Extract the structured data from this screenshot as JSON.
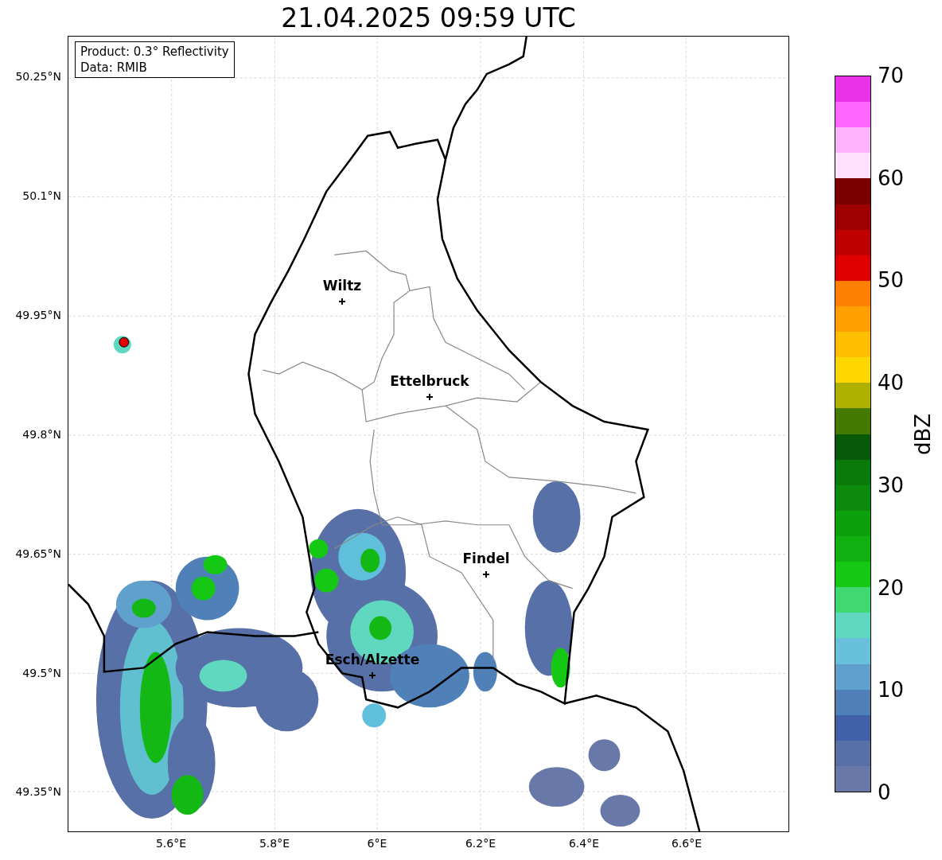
{
  "title": "21.04.2025 09:59 UTC",
  "info_box": [
    "Product: 0.3° Reflectivity",
    "Data: RMIB"
  ],
  "cities": [
    {
      "name": "Wiltz"
    },
    {
      "name": "Ettelbruck"
    },
    {
      "name": "Findel"
    },
    {
      "name": "Esch/Alzette"
    }
  ],
  "y_ticks": [
    "50.25°N",
    "50.1°N",
    "49.95°N",
    "49.8°N",
    "49.65°N",
    "49.5°N",
    "49.35°N"
  ],
  "x_ticks": [
    "5.6°E",
    "5.8°E",
    "6°E",
    "6.2°E",
    "6.4°E",
    "6.6°E"
  ],
  "colorbar": {
    "label": "dBZ",
    "ticks": [
      "70",
      "60",
      "50",
      "40",
      "30",
      "20",
      "10",
      "0"
    ],
    "bands": [
      {
        "color": "#e833e8"
      },
      {
        "color": "#ff66ff"
      },
      {
        "color": "#ffb3ff"
      },
      {
        "color": "#ffe0ff"
      },
      {
        "color": "#7a0000"
      },
      {
        "color": "#9e0000"
      },
      {
        "color": "#c00000"
      },
      {
        "color": "#e00000"
      },
      {
        "color": "#ff7f00"
      },
      {
        "color": "#ff9f00"
      },
      {
        "color": "#ffbf00"
      },
      {
        "color": "#ffd700"
      },
      {
        "color": "#b0b000"
      },
      {
        "color": "#447a00"
      },
      {
        "color": "#085a08"
      },
      {
        "color": "#0a7a0a"
      },
      {
        "color": "#0b8a0b"
      },
      {
        "color": "#0da00d"
      },
      {
        "color": "#10b010"
      },
      {
        "color": "#14c814"
      },
      {
        "color": "#40d870"
      },
      {
        "color": "#60d8c0"
      },
      {
        "color": "#68c0dc"
      },
      {
        "color": "#60a0cc"
      },
      {
        "color": "#5080b8"
      },
      {
        "color": "#4060a8"
      },
      {
        "color": "#5870a8"
      },
      {
        "color": "#6878a8"
      }
    ]
  }
}
